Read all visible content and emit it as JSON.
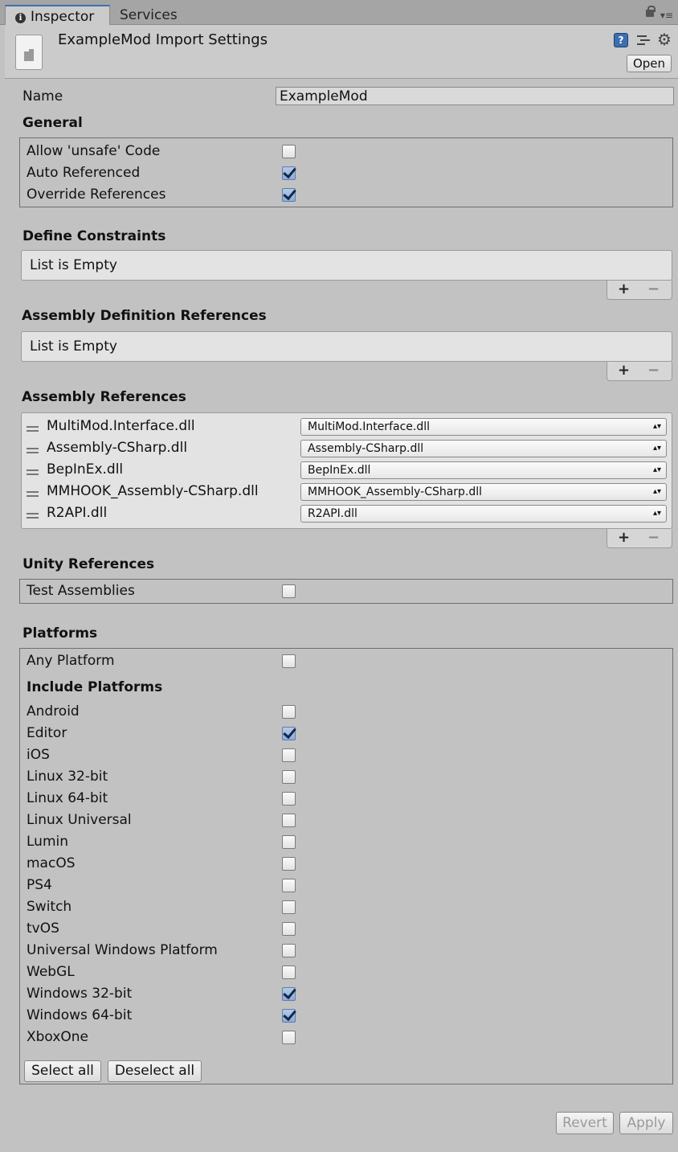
{
  "tabs": {
    "inspector": "Inspector",
    "services": "Services"
  },
  "header": {
    "title": "ExampleMod Import Settings",
    "open_label": "Open",
    "help_icon": "?"
  },
  "name": {
    "label": "Name",
    "value": "ExampleMod"
  },
  "general": {
    "title": "General",
    "items": [
      {
        "label": "Allow 'unsafe' Code",
        "checked": false
      },
      {
        "label": "Auto Referenced",
        "checked": true
      },
      {
        "label": "Override References",
        "checked": true
      }
    ]
  },
  "define_constraints": {
    "title": "Define Constraints",
    "empty": "List is Empty"
  },
  "asmdef_refs": {
    "title": "Assembly Definition References",
    "empty": "List is Empty"
  },
  "assembly_refs": {
    "title": "Assembly References",
    "items": [
      {
        "label": "MultiMod.Interface.dll",
        "value": "MultiMod.Interface.dll"
      },
      {
        "label": "Assembly-CSharp.dll",
        "value": "Assembly-CSharp.dll"
      },
      {
        "label": "BepInEx.dll",
        "value": "BepInEx.dll"
      },
      {
        "label": "MMHOOK_Assembly-CSharp.dll",
        "value": "MMHOOK_Assembly-CSharp.dll"
      },
      {
        "label": "R2API.dll",
        "value": "R2API.dll"
      }
    ]
  },
  "list_buttons": {
    "plus": "+",
    "minus": "−"
  },
  "unity_refs": {
    "title": "Unity References",
    "items": [
      {
        "label": "Test Assemblies",
        "checked": false
      }
    ]
  },
  "platforms": {
    "title": "Platforms",
    "any": {
      "label": "Any Platform",
      "checked": false
    },
    "include_title": "Include Platforms",
    "items": [
      {
        "label": "Android",
        "checked": false
      },
      {
        "label": "Editor",
        "checked": true
      },
      {
        "label": "iOS",
        "checked": false
      },
      {
        "label": "Linux 32-bit",
        "checked": false
      },
      {
        "label": "Linux 64-bit",
        "checked": false
      },
      {
        "label": "Linux Universal",
        "checked": false
      },
      {
        "label": "Lumin",
        "checked": false
      },
      {
        "label": "macOS",
        "checked": false
      },
      {
        "label": "PS4",
        "checked": false
      },
      {
        "label": "Switch",
        "checked": false
      },
      {
        "label": "tvOS",
        "checked": false
      },
      {
        "label": "Universal Windows Platform",
        "checked": false
      },
      {
        "label": "WebGL",
        "checked": false
      },
      {
        "label": "Windows 32-bit",
        "checked": true
      },
      {
        "label": "Windows 64-bit",
        "checked": true
      },
      {
        "label": "XboxOne",
        "checked": false
      }
    ],
    "select_all": "Select all",
    "deselect_all": "Deselect all"
  },
  "footer": {
    "revert": "Revert",
    "apply": "Apply"
  }
}
